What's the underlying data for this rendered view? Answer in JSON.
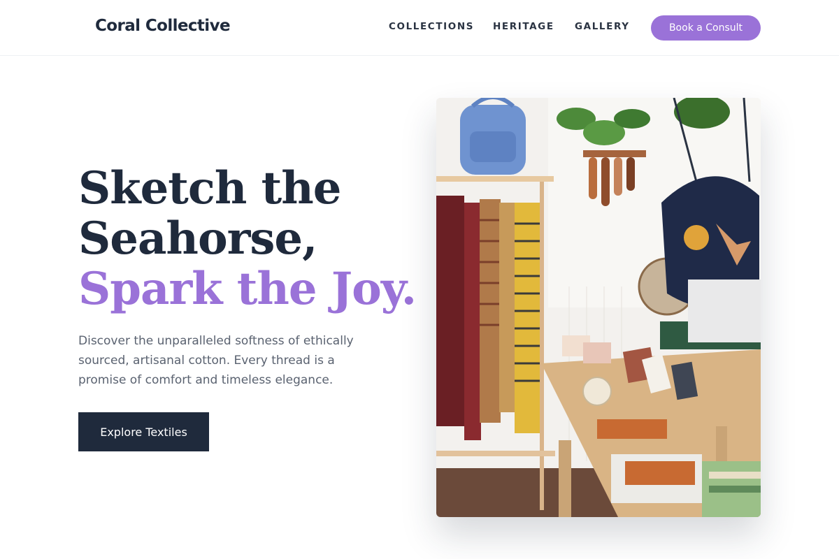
{
  "brand": {
    "name": "Coral Collective"
  },
  "nav": {
    "links": [
      "COLLECTIONS",
      "HERITAGE",
      "GALLERY"
    ],
    "cta_label": "Book a Consult"
  },
  "hero": {
    "headline_line1": "Sketch the",
    "headline_line2": "Seahorse,",
    "headline_accent": "Spark the Joy.",
    "description": "Discover the unparalleled softness of ethically sourced, artisanal cotton. Every thread is a promise of comfort and timeless elegance.",
    "button_label": "Explore Textiles"
  },
  "colors": {
    "primary_dark": "#1f2a3c",
    "accent_purple": "#9a72d8",
    "body_text": "#5a6270"
  }
}
